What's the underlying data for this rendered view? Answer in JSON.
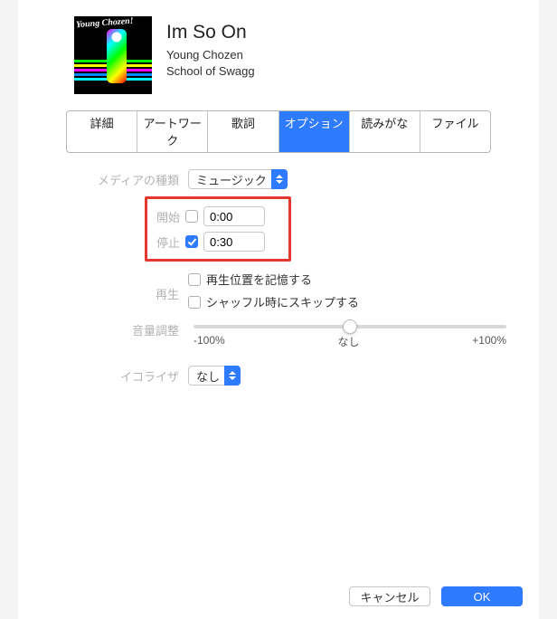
{
  "track": {
    "title": "Im So On",
    "artist": "Young Chozen",
    "album": "School of Swagg"
  },
  "tabs": {
    "detail": "詳細",
    "artwork": "アートワーク",
    "lyrics": "歌詞",
    "options": "オプション",
    "sorting": "読みがな",
    "file": "ファイル"
  },
  "labels": {
    "mediaKind": "メディアの種類",
    "start": "開始",
    "stop": "停止",
    "playback": "再生",
    "volumeAdjust": "音量調整",
    "equalizer": "イコライザ"
  },
  "mediaKind": {
    "value": "ミュージック"
  },
  "start": {
    "checked": false,
    "value": "0:00"
  },
  "stop": {
    "checked": true,
    "value": "0:30"
  },
  "playback": {
    "rememberPosition": {
      "checked": false,
      "label": "再生位置を記憶する"
    },
    "skipShuffle": {
      "checked": false,
      "label": "シャッフル時にスキップする"
    }
  },
  "volume": {
    "min_label": "-100%",
    "center_label": "なし",
    "max_label": "+100%",
    "value": 0
  },
  "equalizer": {
    "value": "なし"
  },
  "buttons": {
    "cancel": "キャンセル",
    "ok": "OK"
  }
}
